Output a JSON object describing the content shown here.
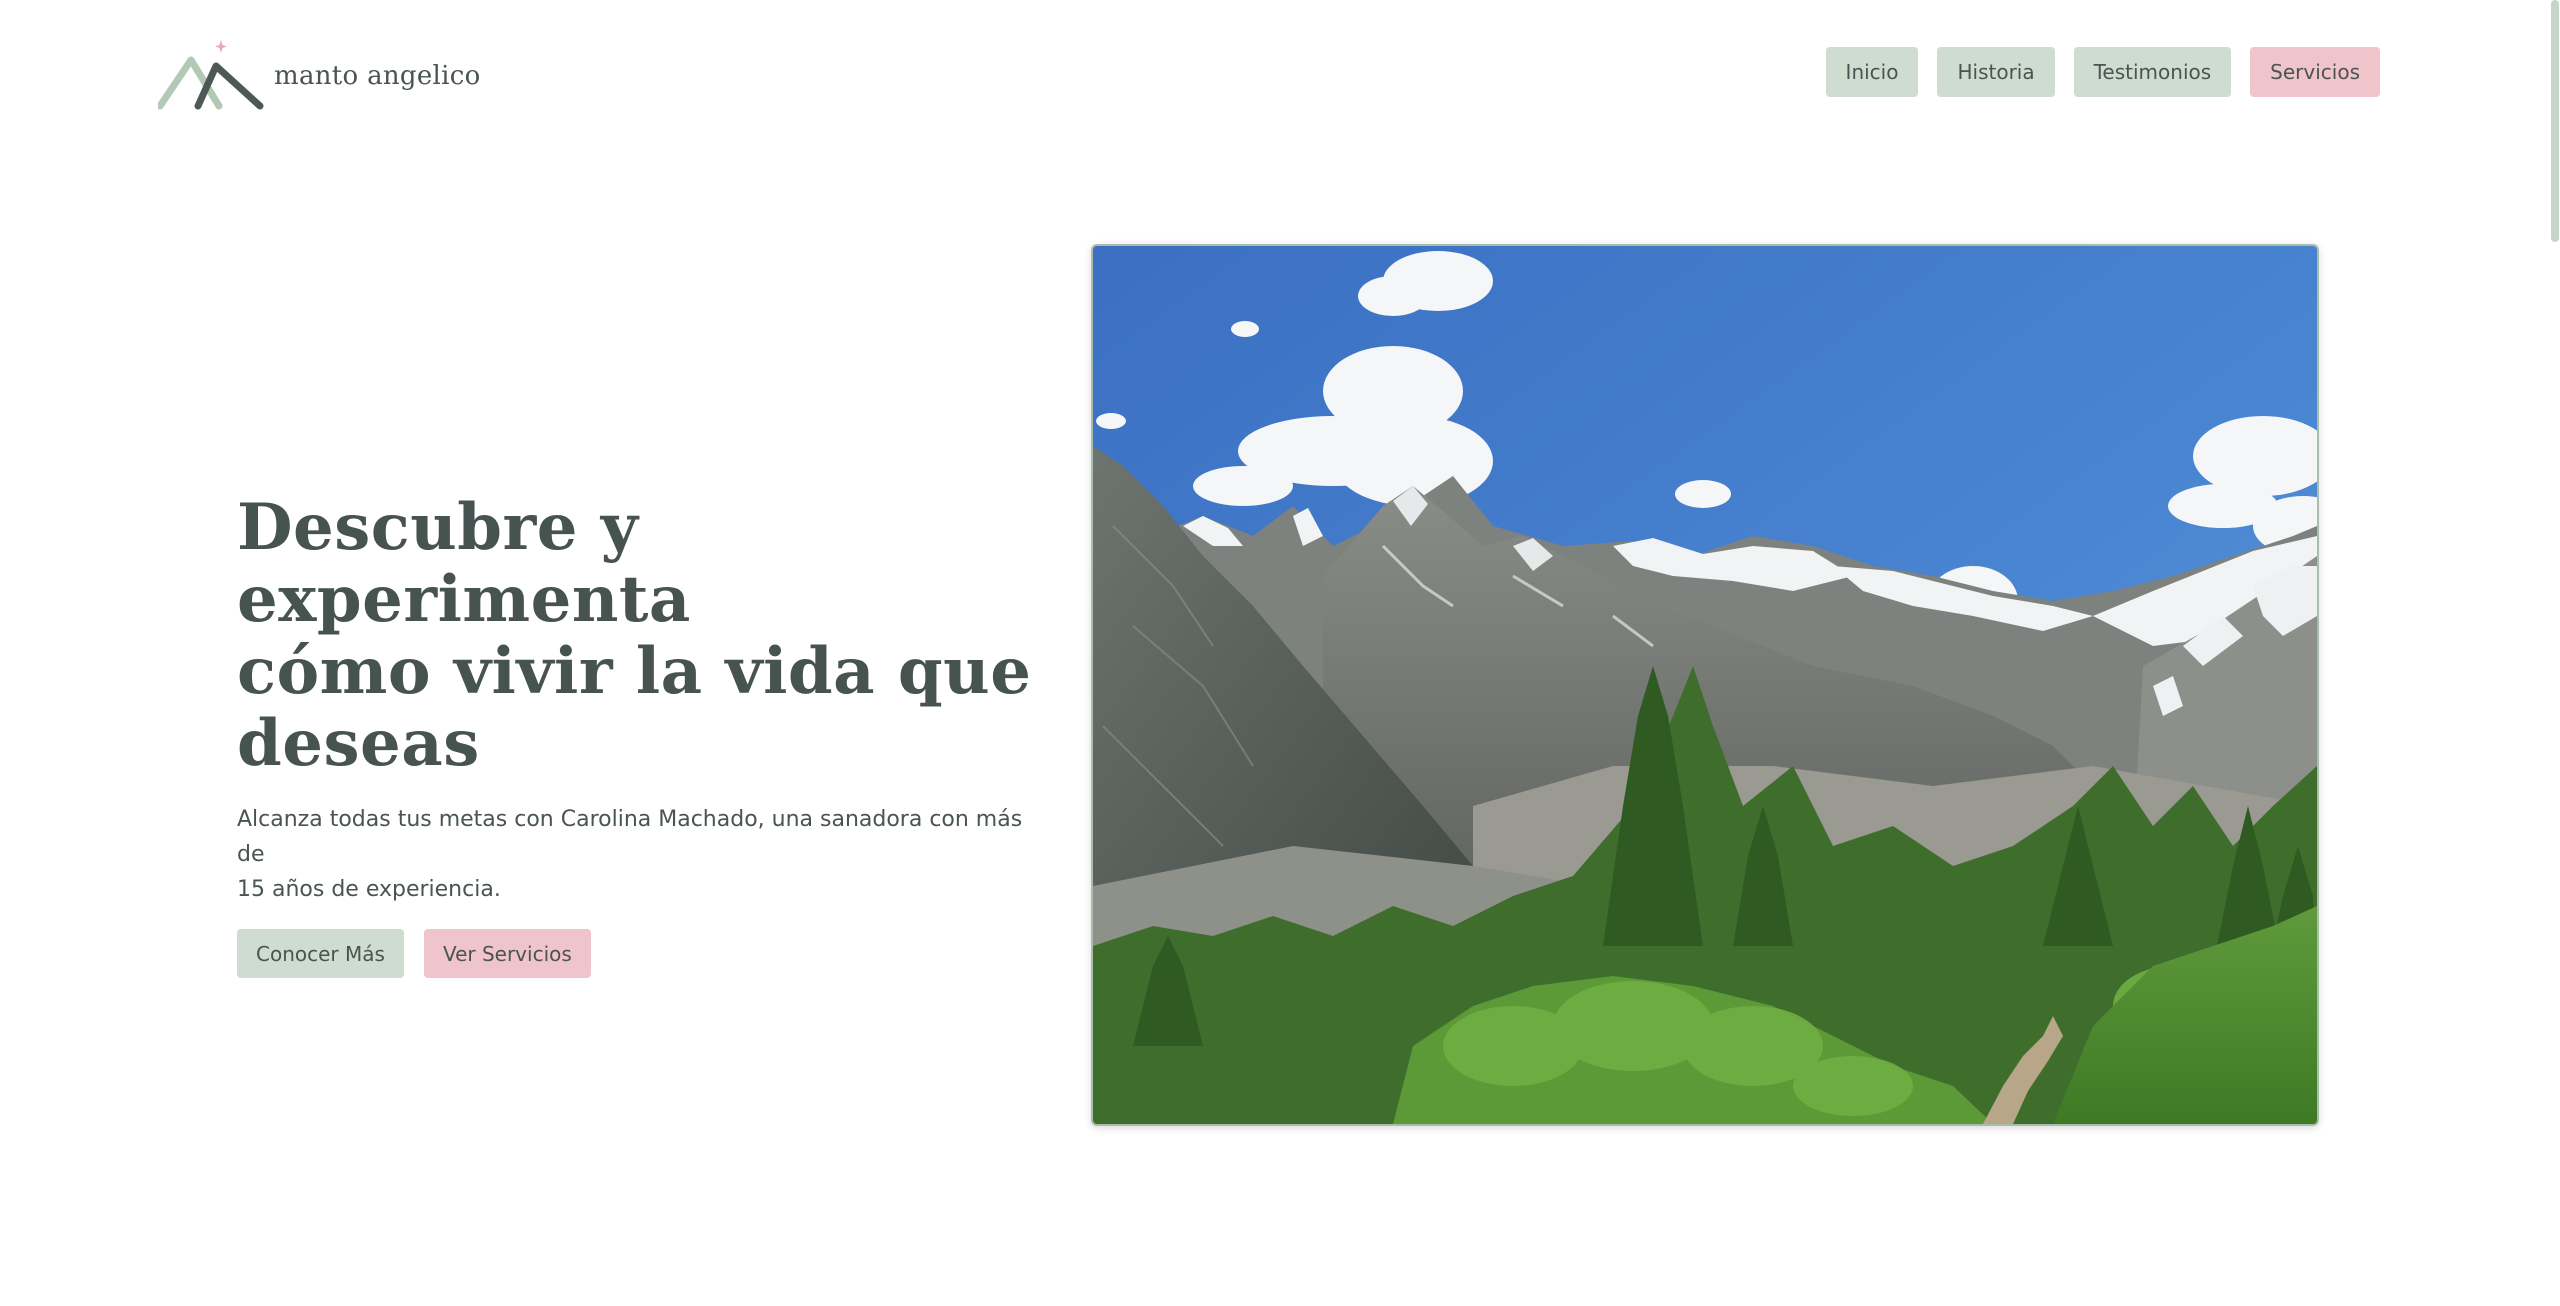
{
  "brand": {
    "name": "manto angelico",
    "logo_icon": "mountain-logo-icon"
  },
  "nav": {
    "items": [
      {
        "label": "Inicio",
        "style": "green"
      },
      {
        "label": "Historia",
        "style": "green"
      },
      {
        "label": "Testimonios",
        "style": "green"
      },
      {
        "label": "Servicios",
        "style": "pink"
      }
    ]
  },
  "hero": {
    "title_lines": [
      "Descubre y experimenta",
      "cómo vivir la vida que",
      "deseas"
    ],
    "subtitle_line1": "Alcanza todas tus metas con Carolina Machado, una sanadora con más de",
    "subtitle_line2": "15 años de experiencia.",
    "primary_button": "Conocer Más",
    "secondary_button": "Ver Servicios",
    "image_icon": "mountain-landscape-photo"
  },
  "colors": {
    "green": "#cfdcd0",
    "pink": "#f0c4cb",
    "text": "#4a5452"
  }
}
